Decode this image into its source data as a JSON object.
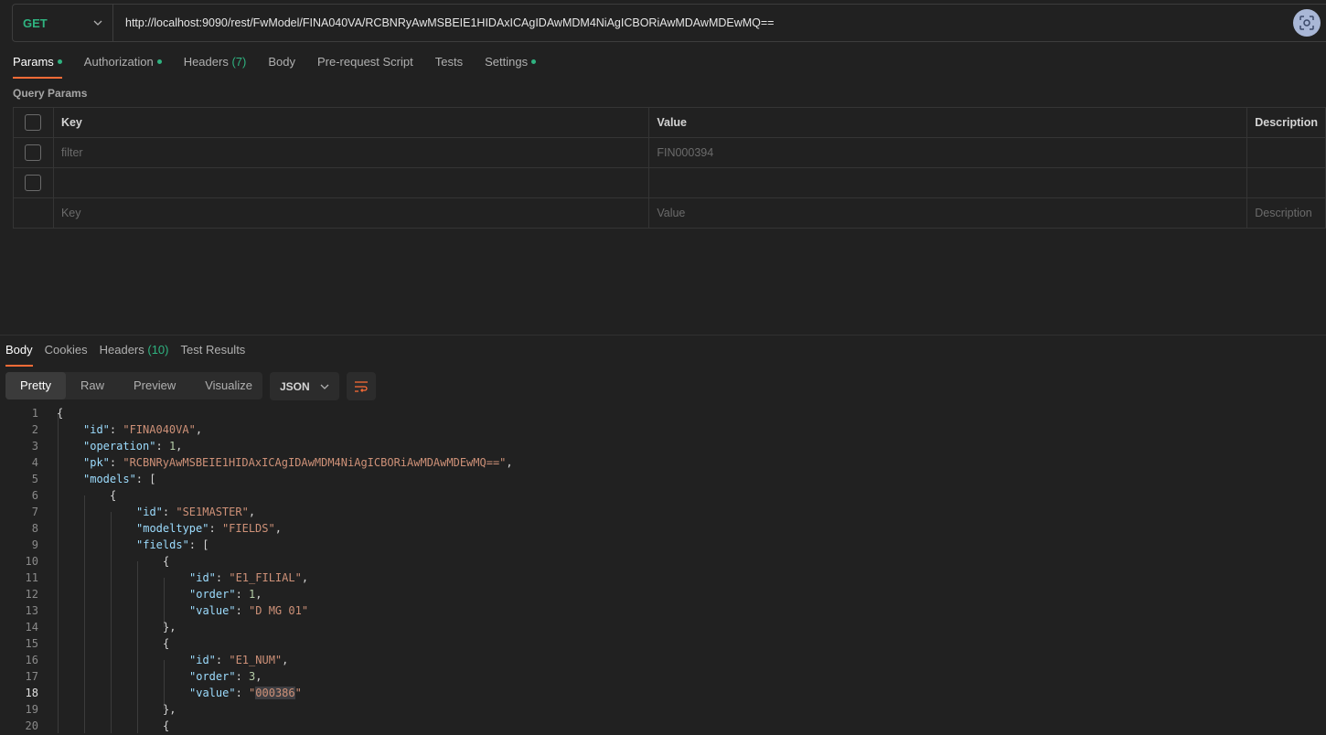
{
  "request": {
    "method": "GET",
    "url": "http://localhost:9090/rest/FwModel/FINA040VA/RCBNRyAwMSBEIE1HIDAxICAgIDAwMDM4NiAgICBORiAwMDAwMDEwMQ=="
  },
  "request_tabs": [
    {
      "label": "Params",
      "dot": true,
      "count": ""
    },
    {
      "label": "Authorization",
      "dot": true,
      "count": ""
    },
    {
      "label": "Headers",
      "dot": false,
      "count": "(7)"
    },
    {
      "label": "Body",
      "dot": false,
      "count": ""
    },
    {
      "label": "Pre-request Script",
      "dot": false,
      "count": ""
    },
    {
      "label": "Tests",
      "dot": false,
      "count": ""
    },
    {
      "label": "Settings",
      "dot": true,
      "count": ""
    }
  ],
  "query_params": {
    "title": "Query Params",
    "headers": {
      "key": "Key",
      "value": "Value",
      "description": "Description"
    },
    "rows": [
      {
        "key": "filter",
        "value": "FIN000394"
      },
      {
        "key": "",
        "value": ""
      }
    ],
    "new_row": {
      "key": "Key",
      "value": "Value",
      "description": "Description"
    }
  },
  "response_tabs": [
    {
      "label": "Body",
      "count": ""
    },
    {
      "label": "Cookies",
      "count": ""
    },
    {
      "label": "Headers",
      "count": "(10)"
    },
    {
      "label": "Test Results",
      "count": ""
    }
  ],
  "viewer": {
    "modes": [
      "Pretty",
      "Raw",
      "Preview",
      "Visualize"
    ],
    "format": "JSON"
  },
  "icons": {
    "method_dropdown": "chevron-down-icon",
    "format_dropdown": "chevron-down-icon",
    "wrap": "wrap-lines-icon",
    "scan": "capture-icon"
  },
  "colors": {
    "method": "#2fb380",
    "accent": "#ff6c37",
    "json_key": "#9cdcfe",
    "json_string": "#ce9178",
    "json_number": "#b5cea8"
  },
  "response_body": [
    {
      "n": "1",
      "indent": 0,
      "tokens": [
        [
          "p",
          "{"
        ]
      ]
    },
    {
      "n": "2",
      "indent": 1,
      "tokens": [
        [
          "k",
          "\"id\""
        ],
        [
          "p",
          ": "
        ],
        [
          "s",
          "\"FINA040VA\""
        ],
        [
          "p",
          ","
        ]
      ]
    },
    {
      "n": "3",
      "indent": 1,
      "tokens": [
        [
          "k",
          "\"operation\""
        ],
        [
          "p",
          ": "
        ],
        [
          "n",
          "1"
        ],
        [
          "p",
          ","
        ]
      ]
    },
    {
      "n": "4",
      "indent": 1,
      "tokens": [
        [
          "k",
          "\"pk\""
        ],
        [
          "p",
          ": "
        ],
        [
          "s",
          "\"RCBNRyAwMSBEIE1HIDAxICAgIDAwMDM4NiAgICBORiAwMDAwMDEwMQ==\""
        ],
        [
          "p",
          ","
        ]
      ]
    },
    {
      "n": "5",
      "indent": 1,
      "tokens": [
        [
          "k",
          "\"models\""
        ],
        [
          "p",
          ": ["
        ]
      ]
    },
    {
      "n": "6",
      "indent": 2,
      "tokens": [
        [
          "p",
          "{"
        ]
      ]
    },
    {
      "n": "7",
      "indent": 3,
      "tokens": [
        [
          "k",
          "\"id\""
        ],
        [
          "p",
          ": "
        ],
        [
          "s",
          "\"SE1MASTER\""
        ],
        [
          "p",
          ","
        ]
      ]
    },
    {
      "n": "8",
      "indent": 3,
      "tokens": [
        [
          "k",
          "\"modeltype\""
        ],
        [
          "p",
          ": "
        ],
        [
          "s",
          "\"FIELDS\""
        ],
        [
          "p",
          ","
        ]
      ]
    },
    {
      "n": "9",
      "indent": 3,
      "tokens": [
        [
          "k",
          "\"fields\""
        ],
        [
          "p",
          ": ["
        ]
      ]
    },
    {
      "n": "10",
      "indent": 4,
      "tokens": [
        [
          "p",
          "{"
        ]
      ]
    },
    {
      "n": "11",
      "indent": 5,
      "tokens": [
        [
          "k",
          "\"id\""
        ],
        [
          "p",
          ": "
        ],
        [
          "s",
          "\"E1_FILIAL\""
        ],
        [
          "p",
          ","
        ]
      ]
    },
    {
      "n": "12",
      "indent": 5,
      "tokens": [
        [
          "k",
          "\"order\""
        ],
        [
          "p",
          ": "
        ],
        [
          "n",
          "1"
        ],
        [
          "p",
          ","
        ]
      ]
    },
    {
      "n": "13",
      "indent": 5,
      "tokens": [
        [
          "k",
          "\"value\""
        ],
        [
          "p",
          ": "
        ],
        [
          "s",
          "\"D MG 01\""
        ]
      ]
    },
    {
      "n": "14",
      "indent": 4,
      "tokens": [
        [
          "p",
          "},"
        ]
      ]
    },
    {
      "n": "15",
      "indent": 4,
      "tokens": [
        [
          "p",
          "{"
        ]
      ]
    },
    {
      "n": "16",
      "indent": 5,
      "tokens": [
        [
          "k",
          "\"id\""
        ],
        [
          "p",
          ": "
        ],
        [
          "s",
          "\"E1_NUM\""
        ],
        [
          "p",
          ","
        ]
      ]
    },
    {
      "n": "17",
      "indent": 5,
      "tokens": [
        [
          "k",
          "\"order\""
        ],
        [
          "p",
          ": "
        ],
        [
          "n",
          "3"
        ],
        [
          "p",
          ","
        ]
      ]
    },
    {
      "n": "18",
      "indent": 5,
      "current": true,
      "tokens": [
        [
          "k",
          "\"value\""
        ],
        [
          "p",
          ": "
        ],
        [
          "s",
          "\""
        ],
        [
          "h",
          "000386"
        ],
        [
          "s",
          "\""
        ]
      ]
    },
    {
      "n": "19",
      "indent": 4,
      "tokens": [
        [
          "p",
          "},"
        ]
      ]
    },
    {
      "n": "20",
      "indent": 4,
      "tokens": [
        [
          "p",
          "{"
        ]
      ]
    }
  ]
}
